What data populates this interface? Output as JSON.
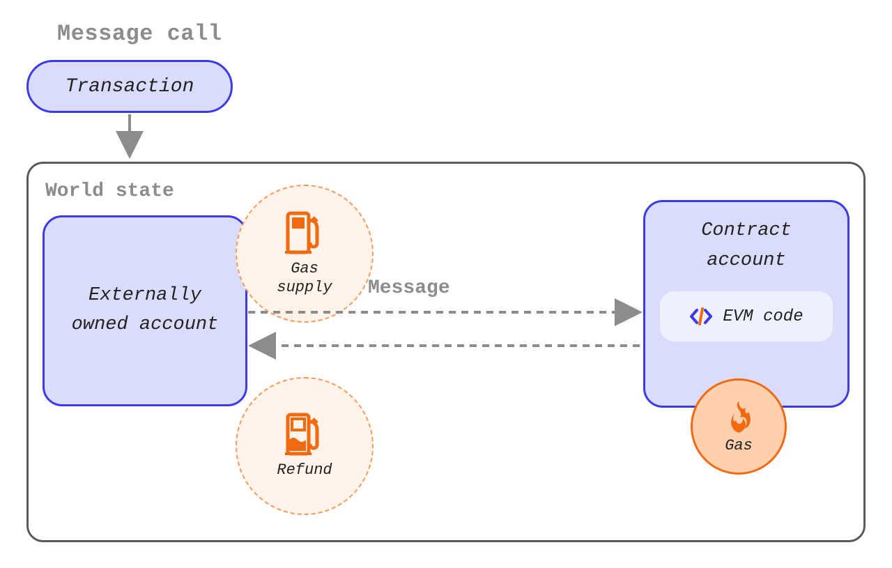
{
  "title": "Message call",
  "transaction": {
    "label": "Transaction"
  },
  "world_state": {
    "label": "World state",
    "externally_owned_account": {
      "label": "Externally\nowned account"
    },
    "gas_supply": {
      "label": "Gas\nsupply"
    },
    "refund": {
      "label": "Refund"
    },
    "message_label": "Message",
    "contract_account": {
      "label": "Contract\naccount",
      "evm_code_label": "EVM code"
    },
    "gas_burn": {
      "label": "Gas"
    }
  },
  "colors": {
    "lavender": "#d9dcfb",
    "indigo": "#3a3ae6",
    "orange": "#f26a0f",
    "peach": "#fff3ea",
    "grey": "#8c8c8c"
  }
}
